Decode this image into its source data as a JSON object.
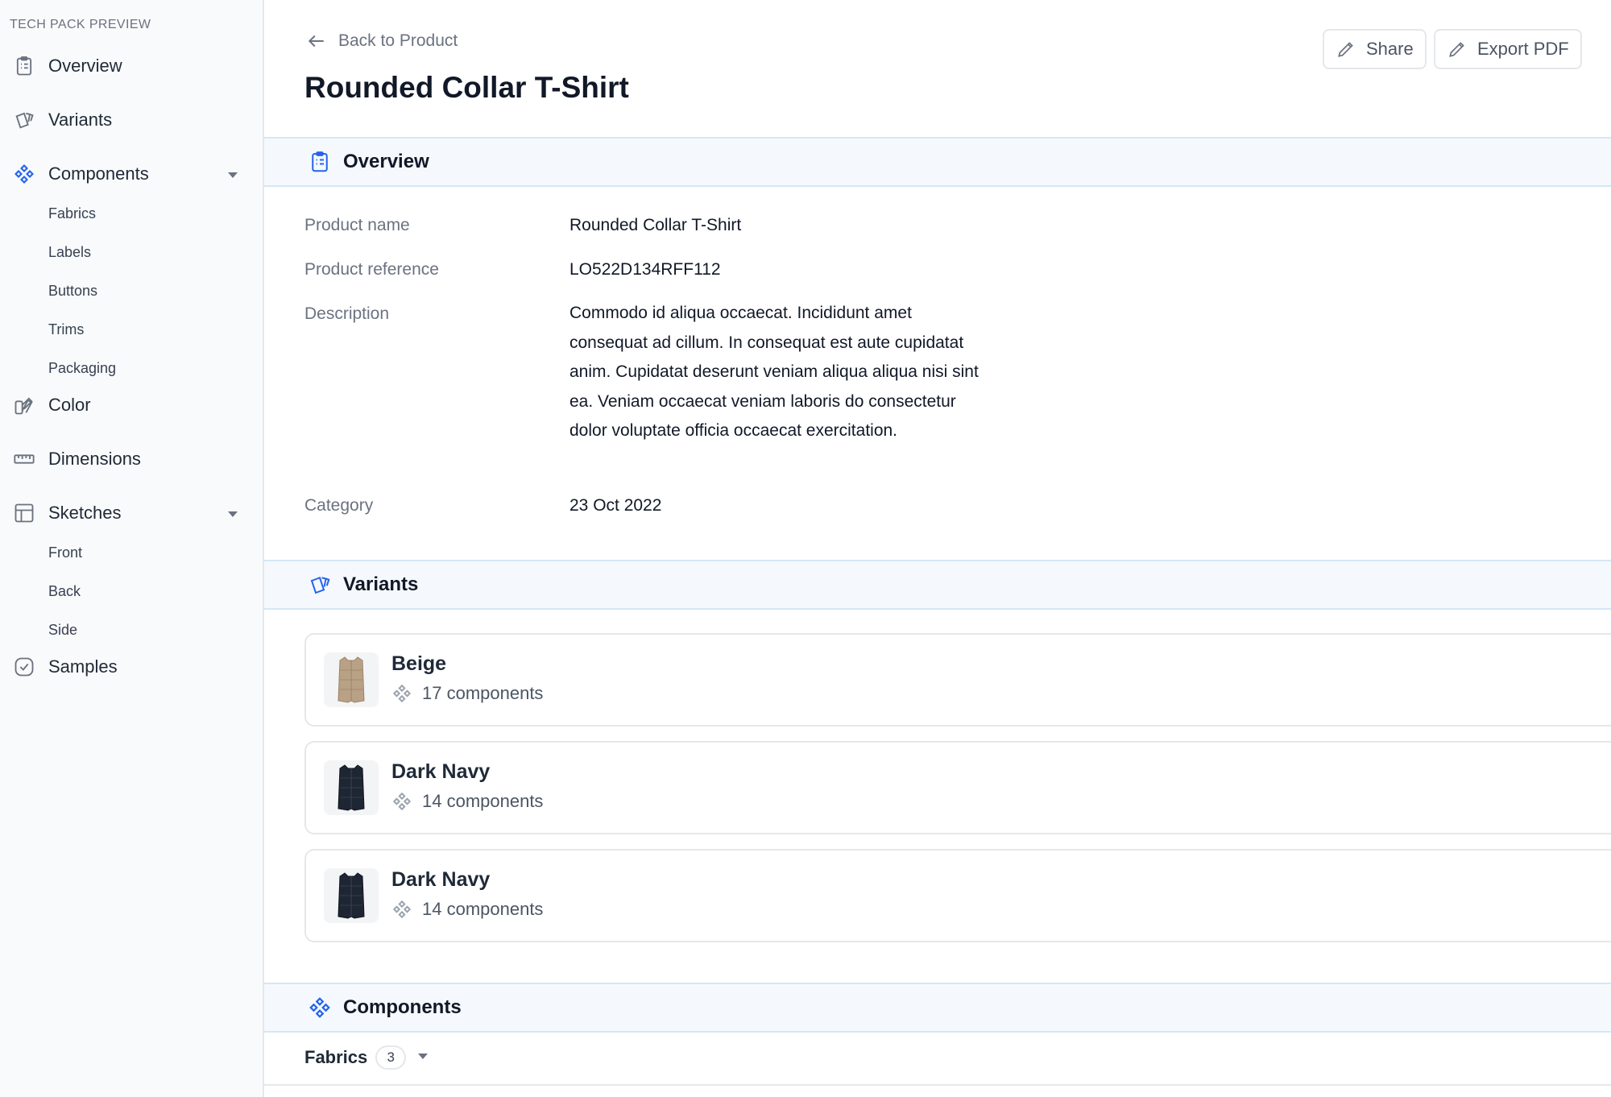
{
  "sidebar": {
    "header": "TECH PACK PREVIEW",
    "overview": "Overview",
    "variants": "Variants",
    "components": "Components",
    "components_items": [
      "Fabrics",
      "Labels",
      "Buttons",
      "Trims",
      "Packaging"
    ],
    "color": "Color",
    "dimensions": "Dimensions",
    "sketches": "Sketches",
    "sketches_items": [
      "Front",
      "Back",
      "Side"
    ],
    "samples": "Samples"
  },
  "header": {
    "back_label": "Back to Product",
    "title": "Rounded Collar T-Shirt",
    "share_label": "Share",
    "export_label": "Export PDF"
  },
  "overview": {
    "section_title": "Overview",
    "fields": [
      {
        "label": "Product name",
        "value": "Rounded Collar T-Shirt"
      },
      {
        "label": "Product reference",
        "value": "LO522D134RFF112"
      },
      {
        "label": "Description",
        "value": "Commodo id aliqua occaecat. Incididunt amet consequat ad cillum. In consequat est aute cupidatat anim. Cupidatat deserunt veniam aliqua aliqua nisi sint ea. Veniam occaecat veniam laboris do consectetur dolor voluptate officia occaecat exercitation."
      },
      {
        "label": "Category",
        "value": "23 Oct 2022"
      }
    ]
  },
  "variants": {
    "section_title": "Variants",
    "items": [
      {
        "name": "Beige",
        "components": "17 components",
        "color": "#b9a185"
      },
      {
        "name": "Dark Navy",
        "components": "14 components",
        "color": "#1f2633"
      },
      {
        "name": "Dark Navy",
        "components": "14 components",
        "color": "#1f2633"
      }
    ]
  },
  "components": {
    "section_title": "Components",
    "fabrics_label": "Fabrics",
    "fabrics_count": "3"
  },
  "colors": {
    "accent": "#2563eb",
    "section_bg": "#f5f9fd"
  }
}
